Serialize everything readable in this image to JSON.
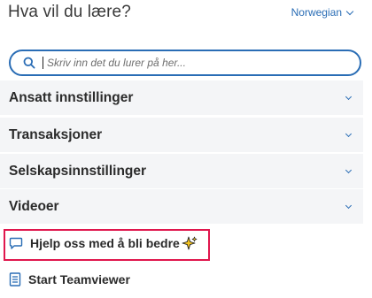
{
  "header": {
    "title": "Hva vil du lære?",
    "language": "Norwegian"
  },
  "search": {
    "placeholder": "Skriv inn det du lurer på her...",
    "value": ""
  },
  "sections": [
    {
      "label": "Ansatt innstillinger"
    },
    {
      "label": "Transaksjoner"
    },
    {
      "label": "Selskapsinnstillinger"
    },
    {
      "label": "Videoer"
    }
  ],
  "links": {
    "feedback": "Hjelp oss med å bli bedre",
    "teamviewer": "Start Teamviewer"
  },
  "colors": {
    "accent": "#2a6db5",
    "highlight_border": "#e0174d",
    "section_bg": "#f4f5f7"
  }
}
